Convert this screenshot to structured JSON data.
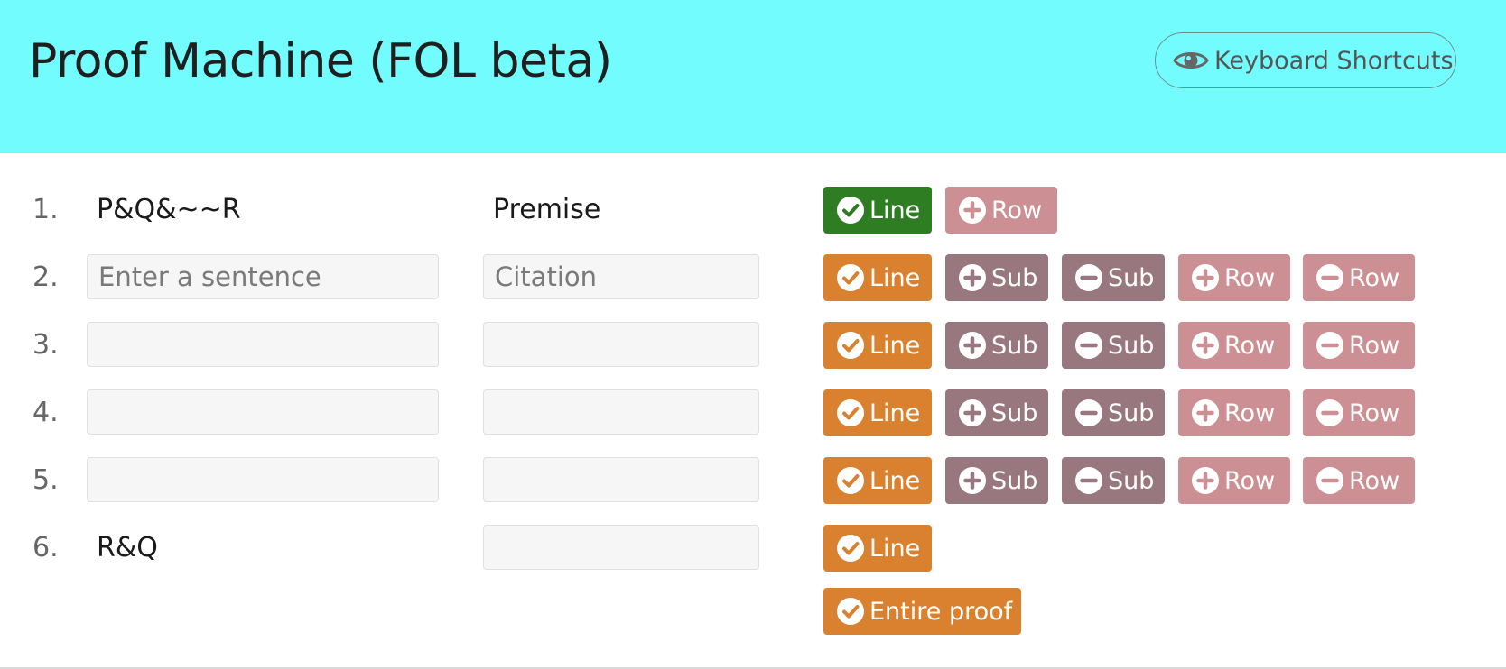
{
  "header": {
    "title": "Proof Machine (FOL beta)",
    "shortcuts_label": "Keyboard Shortcuts"
  },
  "colors": {
    "header_bg": "#73fcfd",
    "line_checked": "#2e7d22",
    "line_unchecked": "#d9812e",
    "sub_buttons": "#99777f",
    "row_buttons": "#cc8f93"
  },
  "buttons": {
    "line": "Line",
    "add_sub": "Sub",
    "remove_sub": "Sub",
    "add_row": "Row",
    "remove_row": "Row",
    "entire_proof": "Entire proof"
  },
  "rows": [
    {
      "number": "1.",
      "sentence": "P&Q&~~R",
      "citation": "Premise",
      "editable": false,
      "line_status": "checked"
    },
    {
      "number": "2.",
      "sentence_value": "",
      "sentence_placeholder": "Enter a sentence",
      "citation_value": "",
      "citation_placeholder": "Citation",
      "editable": true,
      "line_status": "unchecked"
    },
    {
      "number": "3.",
      "sentence_value": "",
      "citation_value": "",
      "editable": true,
      "line_status": "unchecked"
    },
    {
      "number": "4.",
      "sentence_value": "",
      "citation_value": "",
      "editable": true,
      "line_status": "unchecked"
    },
    {
      "number": "5.",
      "sentence_value": "",
      "citation_value": "",
      "editable": true,
      "line_status": "unchecked"
    },
    {
      "number": "6.",
      "sentence": "R&Q",
      "citation_value": "",
      "editable": false,
      "line_status": "unchecked"
    }
  ]
}
